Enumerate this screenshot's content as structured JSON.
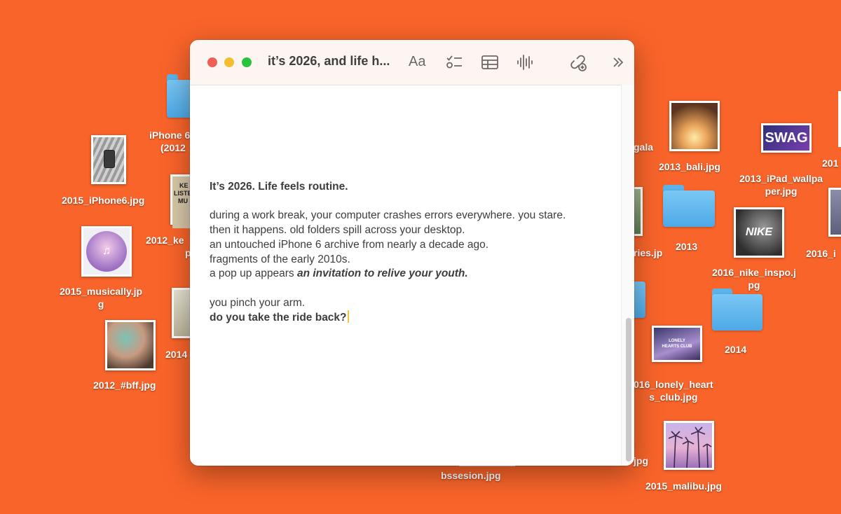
{
  "desktop": {
    "labels": {
      "iphone6_folder_l1": "iPhone 6",
      "iphone6_folder_l2": "(2012",
      "iphone6_jpg": "2015_iPhone6.jpg",
      "keep_l1": "2012_ke",
      "keep_l2": "p",
      "musically_l1": "2015_musically.jp",
      "musically_l2": "g",
      "y2014_partial": "2014",
      "bff": "2012_#bff.jpg",
      "gala_partial": "gala",
      "bali": "2013_bali.jpg",
      "ipad_l1": "2013_iPad_wallpa",
      "ipad_l2": "per.jpg",
      "right_edge_201": "201",
      "right_edge_2016": "2016_i",
      "stories_partial": "ries.jp",
      "folder_2013": "2013",
      "nike_l1": "2016_nike_inspo.j",
      "nike_l2": "pg",
      "folder_2014": "2014",
      "lonely_l1": "016_lonely_heart",
      "lonely_l2": "s_club.jpg",
      "jpg_partial": "jpg",
      "malibu": "2015_malibu.jpg",
      "bssesion": "bssesion.jpg"
    },
    "thumb_text": {
      "swag": "SWAG",
      "nike": "NIKE",
      "lonely": "LONELY HEARTS CLUB",
      "keep_l1": "KE",
      "keep_l2": "LISTE",
      "keep_l3": "MU"
    }
  },
  "window": {
    "title": "it’s 2026, and life h...",
    "toolbar": {
      "format_label": "Aa",
      "icons": [
        "checklist-icon",
        "table-icon",
        "audio-icon",
        "share-link-icon",
        "more-chevrons-icon"
      ]
    },
    "note": {
      "heading": "It’s 2026. Life feels routine.",
      "line1": "during a work break, your computer crashes errors everywhere. you stare.",
      "line2": "then it happens. old folders spill across your desktop.",
      "line3": "an untouched iPhone 6 archive from nearly a decade ago.",
      "line4": "fragments of the early 2010s.",
      "line5_prefix": "a pop up appears ",
      "line5_emphasis": "an invitation to relive your youth.",
      "line6": "you pinch your arm.",
      "line7": "do you take the ride back?"
    }
  },
  "colors": {
    "desktop_bg": "#f9642a",
    "cursor": "#f5c542"
  }
}
